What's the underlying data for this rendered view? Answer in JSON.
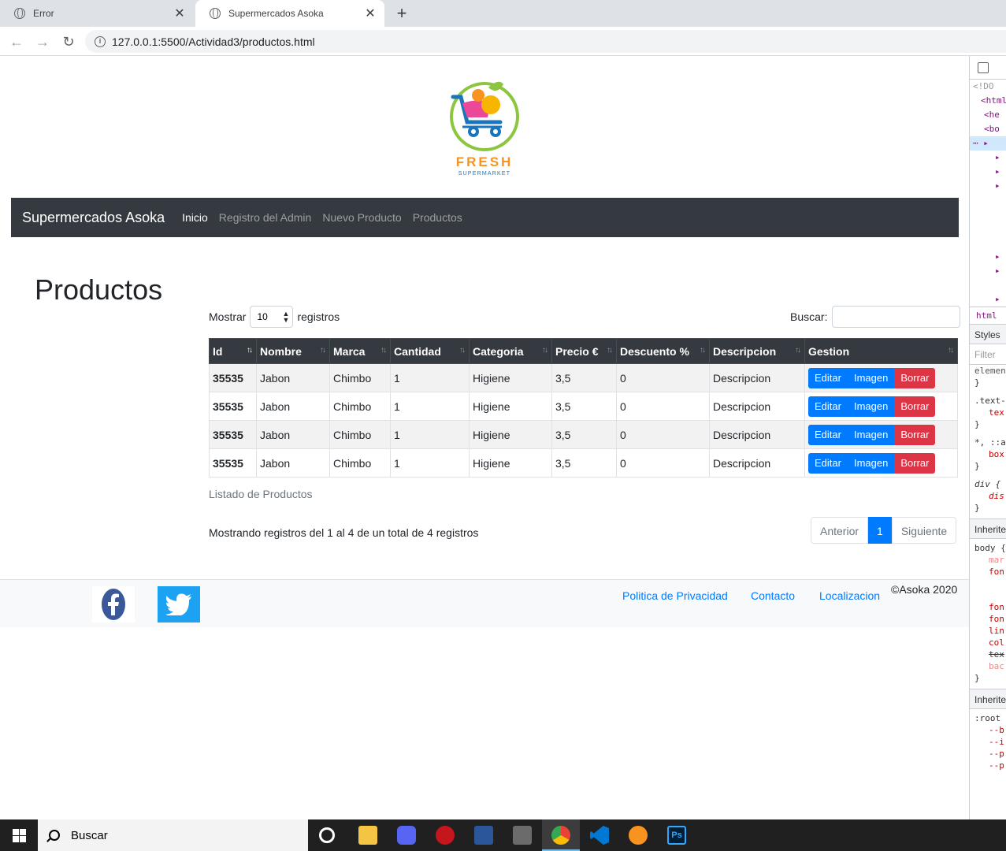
{
  "browser": {
    "tabs": [
      {
        "title": "Error"
      },
      {
        "title": "Supermercados Asoka"
      }
    ],
    "url": "127.0.0.1:5500/Actividad3/productos.html"
  },
  "logo": {
    "word": "FRESH",
    "sub": "SUPERMARKET"
  },
  "navbar": {
    "brand": "Supermercados Asoka",
    "links": [
      "Inicio",
      "Registro del Admin",
      "Nuevo Producto",
      "Productos"
    ]
  },
  "page": {
    "title": "Productos",
    "length_label_before": "Mostrar",
    "length_value": "10",
    "length_label_after": "registros",
    "search_label": "Buscar:",
    "columns": [
      "Id",
      "Nombre",
      "Marca",
      "Cantidad",
      "Categoria",
      "Precio €",
      "Descuento %",
      "Descripcion",
      "Gestion"
    ],
    "rows": [
      {
        "id": "35535",
        "nombre": "Jabon",
        "marca": "Chimbo",
        "cantidad": "1",
        "categoria": "Higiene",
        "precio": "3,5",
        "descuento": "0",
        "descripcion": "Descripcion"
      },
      {
        "id": "35535",
        "nombre": "Jabon",
        "marca": "Chimbo",
        "cantidad": "1",
        "categoria": "Higiene",
        "precio": "3,5",
        "descuento": "0",
        "descripcion": "Descripcion"
      },
      {
        "id": "35535",
        "nombre": "Jabon",
        "marca": "Chimbo",
        "cantidad": "1",
        "categoria": "Higiene",
        "precio": "3,5",
        "descuento": "0",
        "descripcion": "Descripcion"
      },
      {
        "id": "35535",
        "nombre": "Jabon",
        "marca": "Chimbo",
        "cantidad": "1",
        "categoria": "Higiene",
        "precio": "3,5",
        "descuento": "0",
        "descripcion": "Descripcion"
      }
    ],
    "actions": {
      "edit": "Editar",
      "image": "Imagen",
      "delete": "Borrar"
    },
    "caption": "Listado de Productos",
    "info": "Mostrando registros del 1 al 4 de un total de 4 registros",
    "pager": {
      "prev": "Anterior",
      "current": "1",
      "next": "Siguiente"
    }
  },
  "footer": {
    "links": [
      "Politica de Privacidad",
      "Contacto",
      "Localizacion"
    ],
    "copyright": "©Asoka 2020"
  },
  "devtools": {
    "dom_lines": [
      "<!DO",
      "<html",
      "<he",
      "<bo",
      "",
      "",
      "",
      "",
      "",
      "",
      "",
      "",
      "",
      "",
      ""
    ],
    "crumb": "html",
    "styles_tab": "Styles",
    "filter_placeholder": "Filter",
    "rules": [
      "elemen",
      "}",
      ".text-",
      "tex",
      "}",
      "*, ::a",
      "box",
      "}",
      "div {",
      "dis",
      "}"
    ],
    "inherited1": "Inherite",
    "body_rule": [
      "body {",
      "mar",
      "fon",
      "",
      "",
      "fon",
      "fon",
      "lin",
      "col",
      "tex",
      "bac",
      "}"
    ],
    "inherited2": "Inherite",
    "root_rule": [
      ":root",
      "--b",
      "--i",
      "--p",
      "--p"
    ]
  },
  "taskbar": {
    "search_placeholder": "Buscar"
  },
  "colors": {
    "navbar": "#343a40",
    "primary": "#007bff",
    "danger": "#dc3545",
    "footer": "#f8f9fa"
  }
}
